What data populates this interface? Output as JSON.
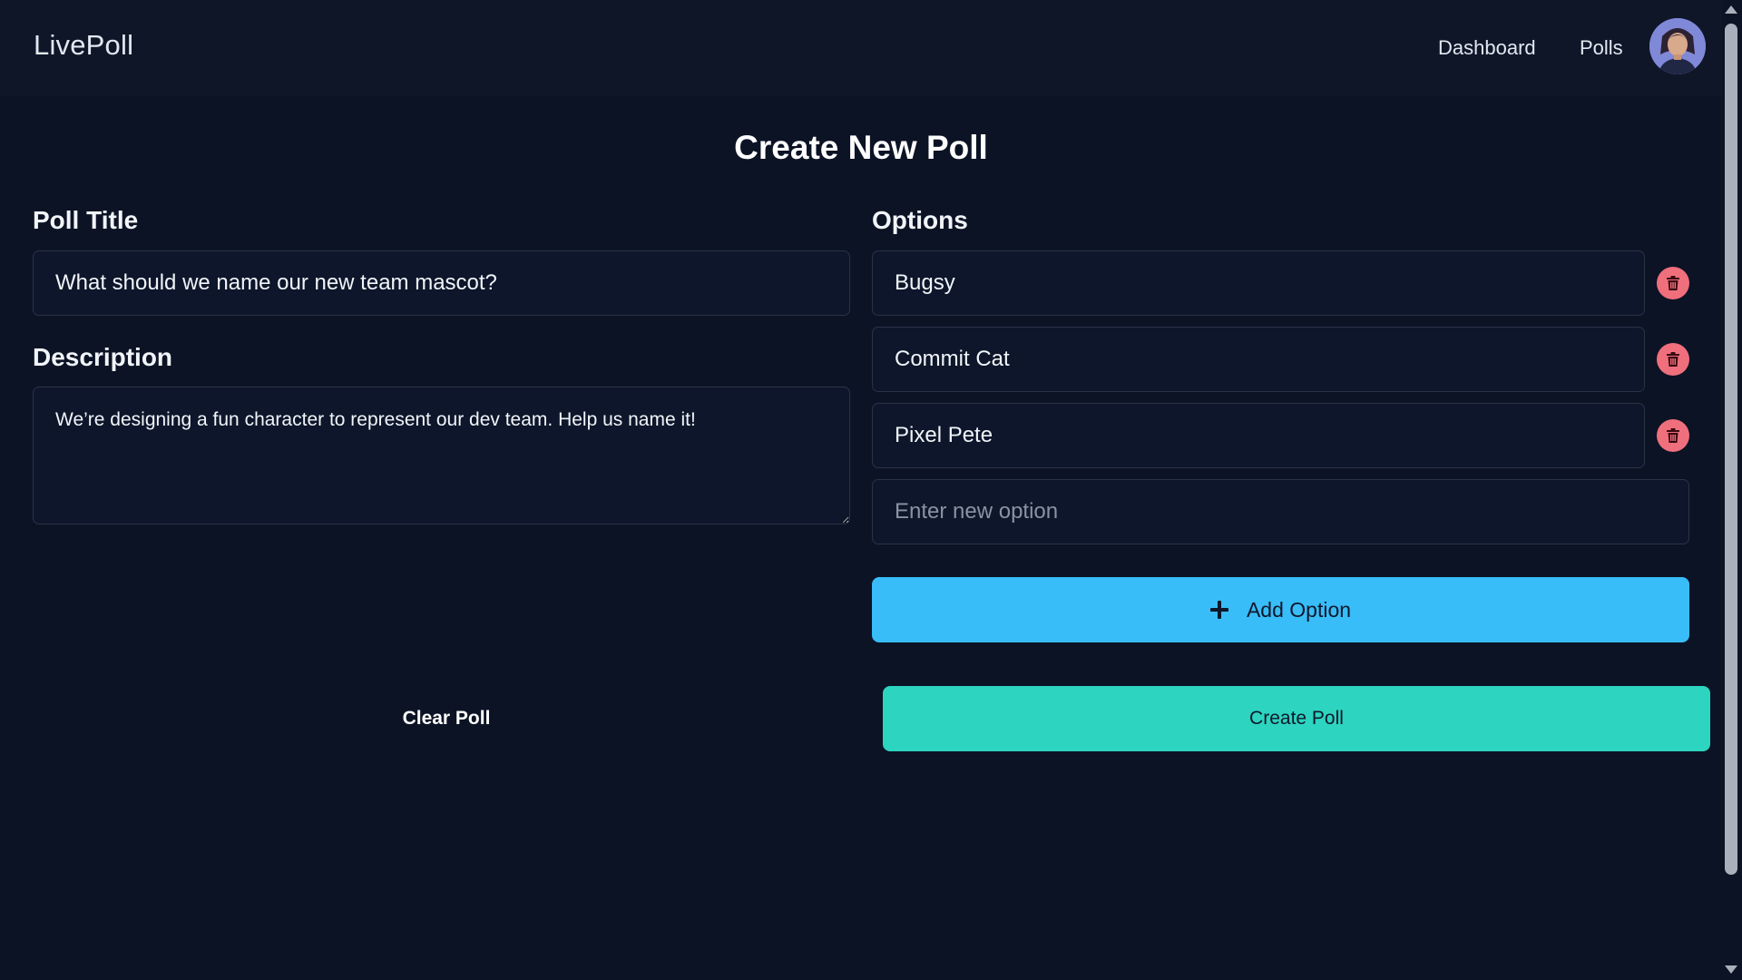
{
  "header": {
    "brand": "LivePoll",
    "nav": [
      {
        "label": "Dashboard"
      },
      {
        "label": "Polls"
      }
    ],
    "avatar_icon": "user-avatar"
  },
  "page": {
    "title": "Create New Poll"
  },
  "form": {
    "title_label": "Poll Title",
    "title_value": "What should we name our new team mascot?",
    "description_label": "Description",
    "description_value": "We’re designing a fun character to represent our dev team. Help us name it!",
    "options_label": "Options",
    "options": [
      {
        "value": "Bugsy"
      },
      {
        "value": "Commit Cat"
      },
      {
        "value": "Pixel Pete"
      }
    ],
    "new_option_placeholder": "Enter new option",
    "add_option_label": "Add Option",
    "clear_label": "Clear Poll",
    "create_label": "Create Poll",
    "delete_icon": "trash-icon"
  },
  "colors": {
    "background": "#0c1325",
    "accent_add": "#38bdf8",
    "accent_create": "#2dd4bf",
    "delete": "#f06f7c"
  }
}
